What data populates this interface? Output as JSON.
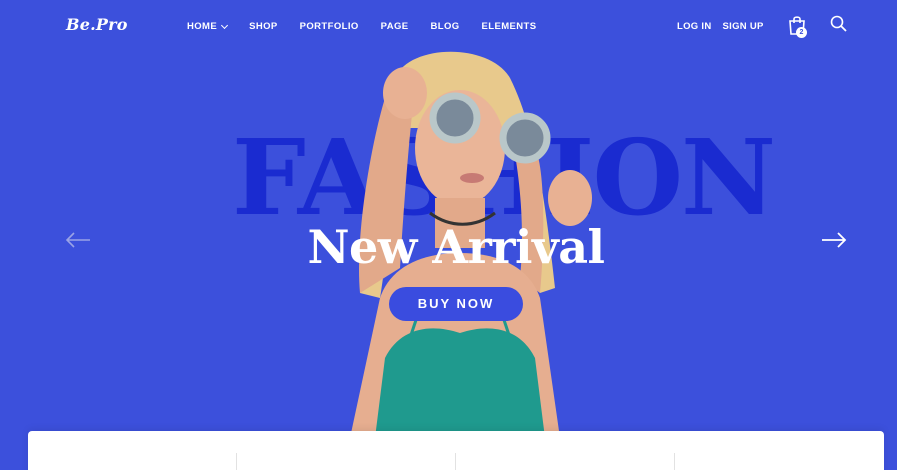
{
  "brand": {
    "logo_text": "Be.Pro"
  },
  "nav": {
    "items": [
      {
        "label": "HOME",
        "has_dropdown": true
      },
      {
        "label": "SHOP",
        "has_dropdown": false
      },
      {
        "label": "PORTFOLIO",
        "has_dropdown": false
      },
      {
        "label": "PAGE",
        "has_dropdown": false
      },
      {
        "label": "BLOG",
        "has_dropdown": false
      },
      {
        "label": "ELEMENTS",
        "has_dropdown": false
      }
    ]
  },
  "auth": {
    "login_label": "LOG IN",
    "signup_label": "SIGN UP"
  },
  "cart": {
    "icon": "shopping-bag-icon",
    "count": "2"
  },
  "search": {
    "icon": "search-icon"
  },
  "hero": {
    "background_word": "FASHION",
    "headline": "New Arrival",
    "cta_label": "BUY NOW",
    "prev_icon": "arrow-left-icon",
    "next_icon": "arrow-right-icon"
  },
  "colors": {
    "background": "#3c50dc",
    "background_word": "#1a2bd0",
    "button": "#3a4cdf",
    "text": "#ffffff"
  }
}
